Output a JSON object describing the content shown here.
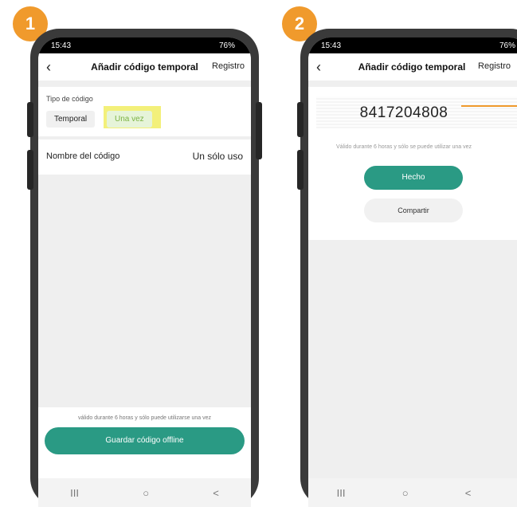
{
  "steps": [
    "1",
    "2"
  ],
  "status_bar": {
    "time": "15:43",
    "battery": "76%"
  },
  "screen1": {
    "title": "Añadir código temporal",
    "right_link": "Registro",
    "code_type_label": "Tipo de código",
    "option_temporal": "Temporal",
    "option_una_vez": "Una vez",
    "code_name_label": "Nombre del código",
    "code_name_value": "Un sólo uso",
    "info_text": "válido durante 6 horas y sólo puede utilizarse una vez",
    "save_button": "Guardar código offline"
  },
  "screen2": {
    "title": "Añadir código temporal",
    "right_link": "Registro",
    "code": "8417204808",
    "info_text": "Válido durante 6 horas y sólo se puede utilizar una vez",
    "done_button": "Hecho",
    "share_button": "Compartir"
  },
  "bottom_nav": {
    "recents": "III",
    "home": "○",
    "back": "<"
  },
  "colors": {
    "accent": "#2a9a84",
    "badge": "#f09a2c",
    "highlight": "#f3f07a",
    "selected_text": "#7cb342"
  }
}
